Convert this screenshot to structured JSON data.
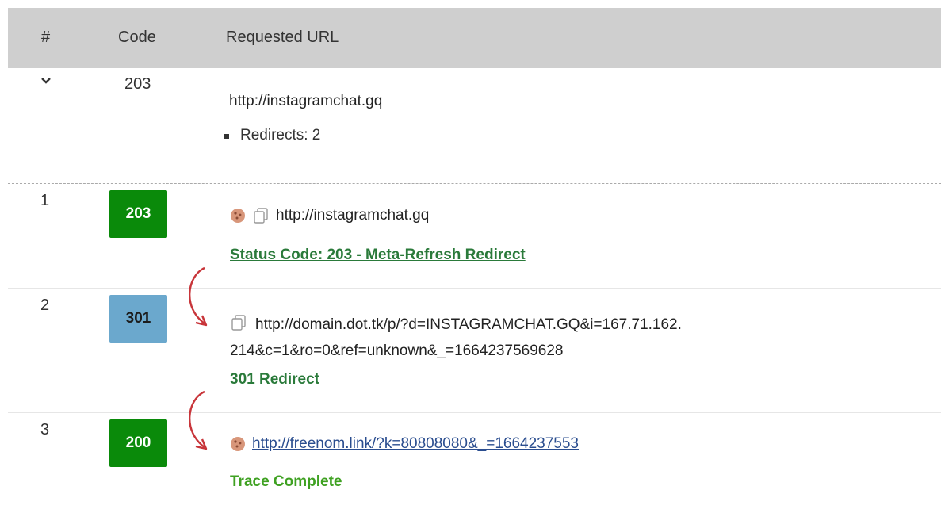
{
  "header": {
    "col_num": "#",
    "col_code": "Code",
    "col_url": "Requested URL"
  },
  "summary": {
    "code": "203",
    "url": "http://instagramchat.gq",
    "redirects": "Redirects: 2"
  },
  "hops": [
    {
      "num": "1",
      "code": "203",
      "url": "http://instagramchat.gq",
      "status": "Status Code: 203 - Meta-Refresh Redirect"
    },
    {
      "num": "2",
      "code": "301",
      "url_line1": "http://domain.dot.tk/p/?d=INSTAGRAMCHAT.GQ&i=167.71.162.",
      "url_line2": "214&c=1&ro=0&ref=unknown&_=1664237569628",
      "status": "301 Redirect"
    },
    {
      "num": "3",
      "code": "200",
      "url": "http://freenom.link/?k=80808080&_=1664237553",
      "status": "Trace Complete"
    }
  ],
  "colors": {
    "header_bg": "#cfcfcf",
    "badge_green": "#0a8a0a",
    "badge_blue": "#6ba8cd",
    "arrow_red": "#c8353a",
    "status_link": "#2a7a3a",
    "trace_complete": "#3fa122",
    "link": "#2a4d8f"
  },
  "icons": [
    "chevron-down-icon",
    "cookie-icon",
    "copy-icon",
    "redirect-arrow-icon"
  ]
}
